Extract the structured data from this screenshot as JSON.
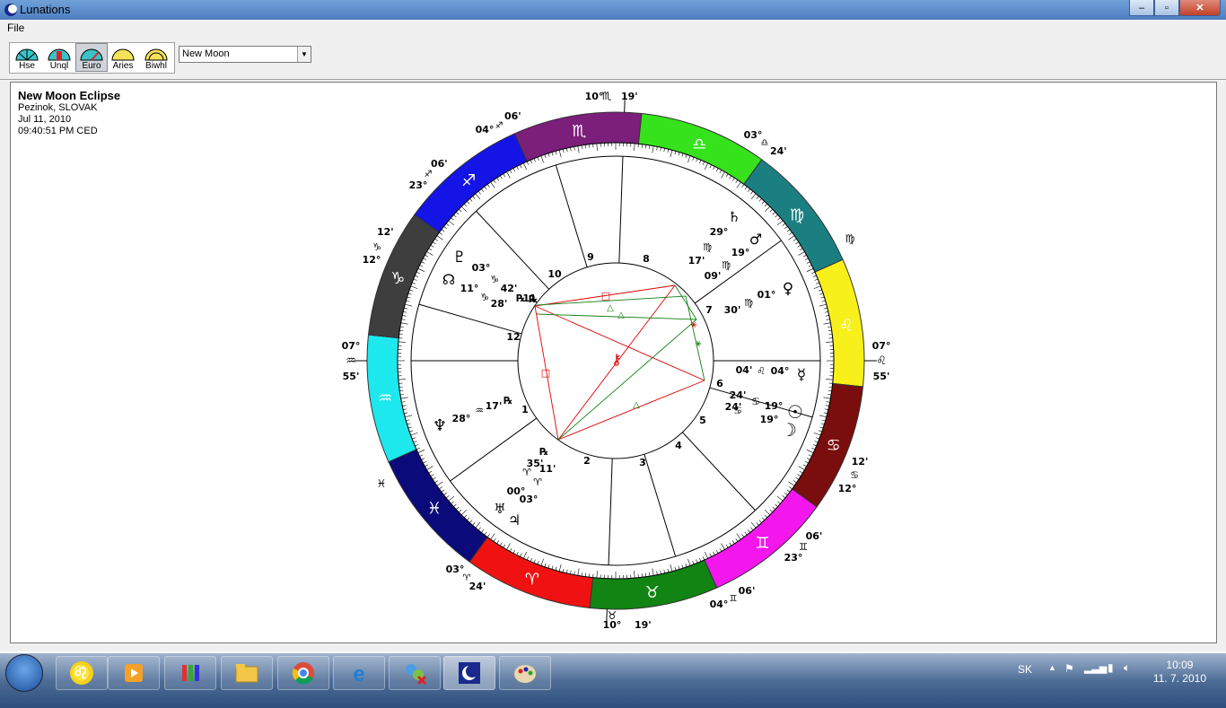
{
  "window": {
    "title": "Lunations"
  },
  "menu": {
    "file": "File"
  },
  "toolbar": {
    "buttons": [
      {
        "label": "Hse"
      },
      {
        "label": "Unql"
      },
      {
        "label": "Euro"
      },
      {
        "label": "Aries"
      },
      {
        "label": "Biwhl"
      }
    ],
    "selected_mode": "Euro",
    "dropdown_value": "New Moon"
  },
  "chart_info": {
    "title": "New Moon Eclipse",
    "location": "Pezinok, SLOVAK",
    "date": "Jul 11, 2010",
    "time": "09:40:51 PM CED"
  },
  "wheel": {
    "house_numbers": [
      "1",
      "2",
      "3",
      "4",
      "5",
      "6",
      "7",
      "8",
      "9",
      "10",
      "11",
      "12"
    ],
    "cusp_labels": {
      "mc": {
        "deg": "10°",
        "sign": "♏",
        "min": "19'"
      },
      "ic": {
        "deg": "10°",
        "sign": "♉",
        "min": "19'"
      },
      "asc": {
        "deg": "07°",
        "sign": "♒",
        "min": "55'"
      },
      "desc": {
        "deg": "07°",
        "sign": "♌",
        "min": "55'"
      },
      "c11a": {
        "deg": "04°",
        "sign": "♐",
        "min": "06'"
      },
      "c11b": {
        "deg": "23°",
        "sign": "♐",
        "min": "06'"
      },
      "c12": {
        "deg": "12°",
        "sign": "♑",
        "min": "12'"
      },
      "c8": {
        "deg": "03°",
        "sign": "♎",
        "min": "24'"
      },
      "c7": {
        "sign": "♍"
      },
      "c5": {
        "deg": "12°",
        "sign": "♋",
        "min": "12'"
      },
      "c4a": {
        "deg": "23°",
        "sign": "♊",
        "min": "06'"
      },
      "c4b": {
        "deg": "04°",
        "sign": "♊",
        "min": "06'"
      },
      "c2": {
        "deg": "03°",
        "sign": "♈",
        "min": "24'"
      },
      "c1": {
        "sign": "♓"
      }
    },
    "planets": [
      {
        "name": "Pluto",
        "glyph": "♇",
        "pos": [
          "03°",
          "♑",
          "42'",
          "℞"
        ]
      },
      {
        "name": "North Node",
        "glyph": "☊",
        "pos": [
          "11°",
          "♑",
          "28'",
          "℞"
        ]
      },
      {
        "name": "Neptune",
        "glyph": "♆",
        "pos": [
          "28°",
          "♒",
          "17'",
          "℞"
        ]
      },
      {
        "name": "Uranus",
        "glyph": "♅",
        "pos": [
          "00°",
          "♈",
          "35'",
          "℞"
        ]
      },
      {
        "name": "Jupiter",
        "glyph": "♃",
        "pos": [
          "03°",
          "♈",
          "11'"
        ]
      },
      {
        "name": "Saturn",
        "glyph": "♄",
        "pos": [
          "29°",
          "♍",
          "17'"
        ]
      },
      {
        "name": "Mars",
        "glyph": "♂",
        "pos": [
          "19°",
          "♍",
          "09'"
        ]
      },
      {
        "name": "Venus",
        "glyph": "♀",
        "pos": [
          "01°",
          "♍",
          "30'"
        ]
      },
      {
        "name": "Mercury",
        "glyph": "☿",
        "pos": [
          "04°",
          "♌",
          "04'"
        ]
      },
      {
        "name": "Sun",
        "glyph": "☉",
        "pos": [
          "19°",
          "♋",
          "24'"
        ]
      },
      {
        "name": "Moon",
        "glyph": "☽",
        "pos": [
          "19°",
          "♋",
          "24'"
        ]
      }
    ],
    "sign_glyphs": [
      "♈",
      "♉",
      "♊",
      "♋",
      "♌",
      "♍",
      "♎",
      "♏",
      "♐",
      "♑",
      "♒",
      "♓"
    ]
  },
  "taskbar": {
    "lang": "SK",
    "time": "10:09",
    "date": "11. 7. 2010"
  }
}
